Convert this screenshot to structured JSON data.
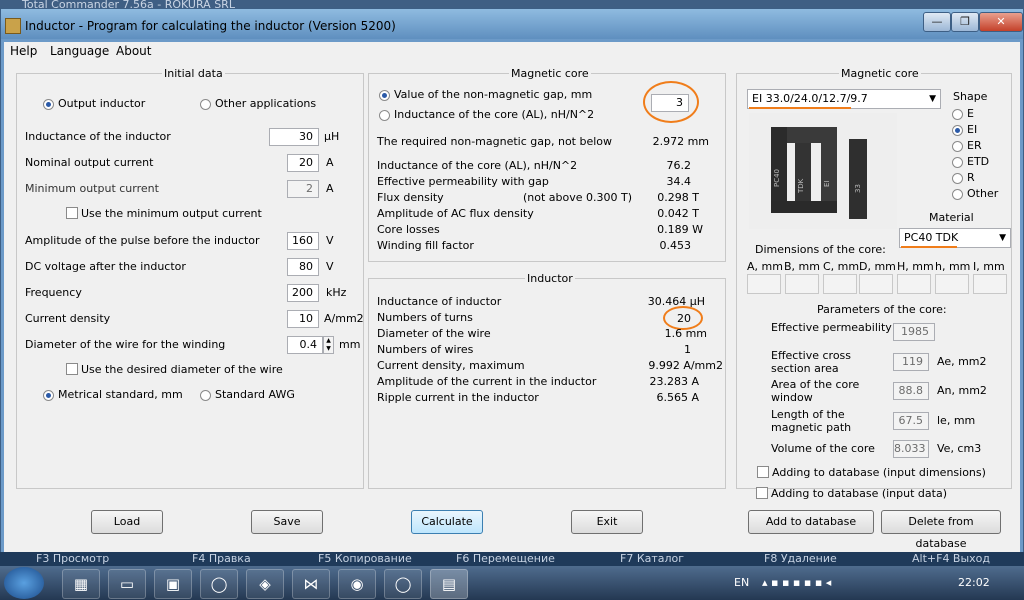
{
  "background_window_title": "Total Commander 7.56a - ROKURA SRL",
  "window": {
    "title": "Inductor - Program for calculating the inductor (Version 5200)",
    "minimize": "—",
    "maximize": "❐",
    "close": "✕"
  },
  "menu": [
    "Help",
    "Language",
    "About"
  ],
  "initial_data": {
    "title": "Initial data",
    "radio_output": "Output inductor",
    "radio_other": "Other applications",
    "fields": [
      {
        "label": "Inductance of the inductor",
        "value": "30",
        "unit": "µH"
      },
      {
        "label": "Nominal output current",
        "value": "20",
        "unit": "A"
      },
      {
        "label": "Minimum output current",
        "value": "2",
        "unit": "A"
      }
    ],
    "chk_min_current": "Use the minimum output current",
    "fields2": [
      {
        "label": "Amplitude of the pulse before the inductor",
        "value": "160",
        "unit": "V"
      },
      {
        "label": "DC voltage after the inductor",
        "value": "80",
        "unit": "V"
      },
      {
        "label": "Frequency",
        "value": "200",
        "unit": "kHz"
      },
      {
        "label": "Current density",
        "value": "10",
        "unit": "A/mm2"
      },
      {
        "label": "Diameter of the wire for the winding",
        "value": "0.4",
        "unit": "mm"
      }
    ],
    "chk_wire": "Use the desired diameter of the wire",
    "radio_metric": "Metrical standard, mm",
    "radio_awg": "Standard AWG"
  },
  "magnetic_core_mid": {
    "title": "Magnetic core",
    "radio_gap": "Value of the non-magnetic gap, mm",
    "gap_value": "3",
    "radio_al": "Inductance of the core (AL), nH/N^2",
    "results": [
      {
        "label": "The required non-magnetic gap, not below",
        "value": "2.972 mm"
      },
      {
        "label": "Inductance of the core (AL), nH/N^2",
        "value": "76.2"
      },
      {
        "label": "Effective permeability with gap",
        "value": "34.4"
      },
      {
        "label": "Flux density",
        "note": "(not above 0.300 T)",
        "value": "0.298 T"
      },
      {
        "label": "Amplitude of AC flux density",
        "value": "0.042 T"
      },
      {
        "label": "Core losses",
        "value": "0.189 W"
      },
      {
        "label": "Winding fill factor",
        "value": "0.453"
      }
    ]
  },
  "inductor": {
    "title": "Inductor",
    "rows": [
      {
        "label": "Inductance of inductor",
        "value": "30.464 µH"
      },
      {
        "label": "Numbers of turns",
        "value": "20"
      },
      {
        "label": "Diameter of the wire",
        "value": "1.6 mm"
      },
      {
        "label": "Numbers of wires",
        "value": "1"
      },
      {
        "label": "Current density, maximum",
        "value": "9.992 A/mm2"
      },
      {
        "label": "Amplitude of the current in the inductor",
        "value": "23.283 A"
      },
      {
        "label": "Ripple current in the inductor",
        "value": "6.565 A"
      }
    ]
  },
  "magnetic_core_right": {
    "title": "Magnetic core",
    "core_selected": "EI 33.0/24.0/12.7/9.7",
    "shape_title": "Shape",
    "shapes": [
      "E",
      "EI",
      "ER",
      "ETD",
      "R",
      "Other"
    ],
    "shape_selected": "EI",
    "material_title": "Material",
    "material_selected": "PC40 TDK",
    "core_image_text": [
      "PC40",
      "TDK",
      "EI",
      "33"
    ],
    "dims_title": "Dimensions of the core:",
    "dims": [
      "A, mm",
      "B, mm",
      "C, mm",
      "D, mm",
      "H, mm",
      "h, mm",
      "I, mm"
    ],
    "params_title": "Parameters of the core:",
    "params": [
      {
        "label": "Effective permeability",
        "value": "1985",
        "unit": ""
      },
      {
        "label": "Effective cross section area",
        "value": "119",
        "unit": "Ae, mm2"
      },
      {
        "label": "Area of the core window",
        "value": "88.8",
        "unit": "An, mm2"
      },
      {
        "label": "Length of the magnetic path",
        "value": "67.5",
        "unit": "le, mm"
      },
      {
        "label": "Volume of the core",
        "value": "8.033",
        "unit": "Ve, cm3"
      }
    ],
    "chk_db_dims": "Adding to database (input dimensions)",
    "chk_db_data": "Adding to database (input data)"
  },
  "buttons": {
    "load": "Load",
    "save": "Save",
    "calculate": "Calculate",
    "exit": "Exit",
    "add_db": "Add to database",
    "del_db": "Delete from database"
  },
  "fkeys": [
    "F3 Просмотр",
    "F4 Правка",
    "F5 Копирование",
    "F6 Перемещение",
    "F7 Каталог",
    "F8 Удаление",
    "Alt+F4 Выход"
  ],
  "taskbar": {
    "lang": "EN",
    "clock": "22:02"
  },
  "colors": {
    "annotation": "#f07d1a",
    "accent": "#2b5aa8"
  }
}
